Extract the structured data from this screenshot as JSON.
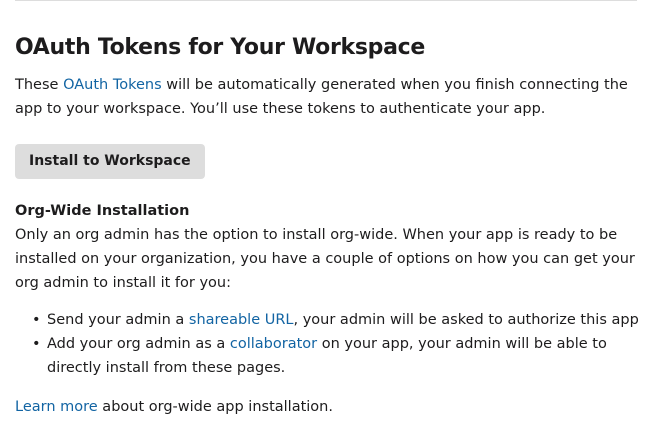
{
  "heading": "OAuth Tokens for Your Workspace",
  "intro": {
    "prefix": "These ",
    "link": "OAuth Tokens",
    "suffix": " will be automatically generated when you finish connecting the app to your workspace. You’ll use these tokens to authenticate your app."
  },
  "install_button": "Install to Workspace",
  "org_wide": {
    "title": "Org-Wide Installation",
    "description": "Only an org admin has the option to install org-wide. When your app is ready to be installed on your organization, you have a couple of options on how you can get your org admin to install it for you:"
  },
  "options": [
    {
      "prefix": "Send your admin a ",
      "link": "shareable URL",
      "suffix": ", your admin will be asked to authorize this app"
    },
    {
      "prefix": "Add your org admin as a ",
      "link": "collaborator",
      "suffix": " on your app, your admin will be able to directly install from these pages."
    }
  ],
  "learn_more": {
    "link": "Learn more",
    "suffix": " about org-wide app installation."
  },
  "colors": {
    "link": "#1264a3",
    "text": "#1d1c1d",
    "button_bg": "#dddddd",
    "divider": "#dddddd"
  }
}
